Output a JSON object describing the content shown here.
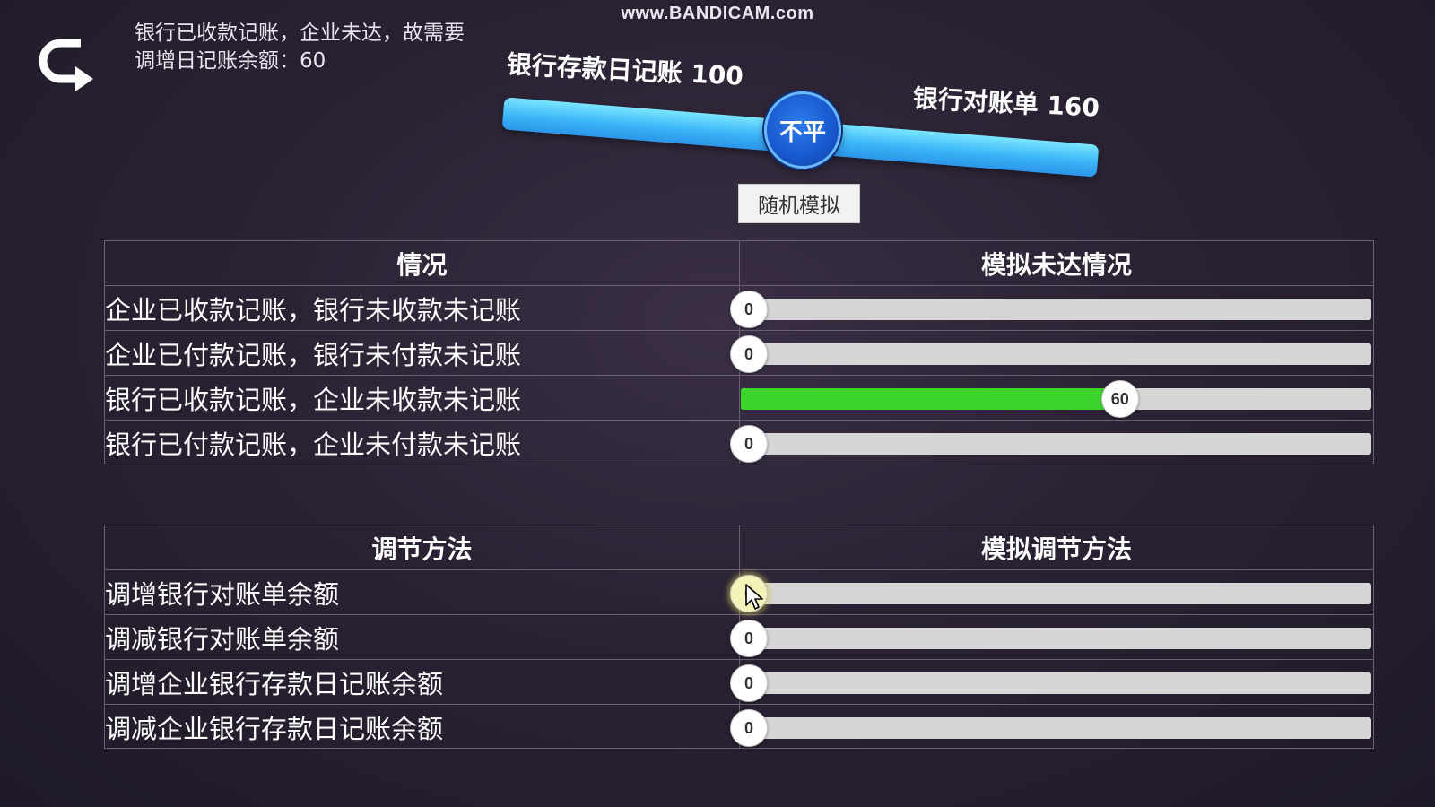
{
  "watermark": "www.BANDICAM.com",
  "hint": {
    "line1": "银行已收款记账，企业未达，故需要",
    "line2": "调增日记账余额：60"
  },
  "balance": {
    "left_label": "银行存款日记账 100",
    "right_label": "银行对账单 160",
    "status": "不平",
    "beam_color": "#3ab5f7"
  },
  "random_button_label": "随机模拟",
  "situation_table": {
    "header_left": "情况",
    "header_right": "模拟未达情况",
    "rows": [
      {
        "label": "企业已收款记账，银行未收款未记账",
        "value": "0",
        "fraction": 0
      },
      {
        "label": "企业已付款记账，银行未付款未记账",
        "value": "0",
        "fraction": 0
      },
      {
        "label": "银行已收款记账，企业未收款未记账",
        "value": "60",
        "fraction": 0.6
      },
      {
        "label": "银行已付款记账，企业未付款未记账",
        "value": "0",
        "fraction": 0
      }
    ]
  },
  "adjust_table": {
    "header_left": "调节方法",
    "header_right": "模拟调节方法",
    "rows": [
      {
        "label": "调增银行对账单余额",
        "value": "0",
        "fraction": 0
      },
      {
        "label": "调减银行对账单余额",
        "value": "0",
        "fraction": 0
      },
      {
        "label": "调增企业银行存款日记账余额",
        "value": "0",
        "fraction": 0
      },
      {
        "label": "调减企业银行存款日记账余额",
        "value": "0",
        "fraction": 0
      }
    ]
  },
  "colors": {
    "slider_fill": "#3bd52c",
    "slider_track": "#d6d6d6",
    "pivot": "#1858cc"
  },
  "icons": {
    "back": "back-arrow-icon",
    "cursor": "mouse-cursor-icon"
  }
}
